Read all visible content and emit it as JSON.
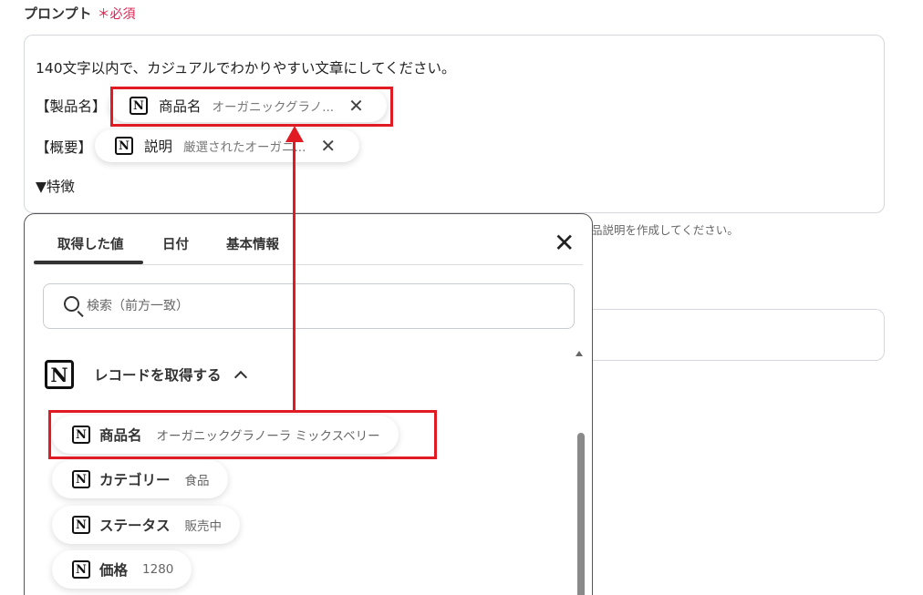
{
  "form": {
    "label": "プロンプト",
    "required_label": "＊必須"
  },
  "prompt": {
    "line1": "140文字以内で、カジュアルでわかりやすい文章にしてください。",
    "product_label": "【製品名】",
    "overview_label": "【概要】",
    "features_label": "▼特徴",
    "chips": [
      {
        "name": "商品名",
        "value": "オーガニックグラノ..."
      },
      {
        "name": "説明",
        "value": "厳選されたオーガニ..."
      }
    ]
  },
  "hint_text": "品説明を作成してください。",
  "picker": {
    "tabs": [
      {
        "label": "取得した値",
        "active": true
      },
      {
        "label": "日付"
      },
      {
        "label": "基本情報"
      }
    ],
    "search_placeholder": "検索（前方一致）",
    "group_label": "レコードを取得する",
    "items": [
      {
        "name": "商品名",
        "value": "オーガニックグラノーラ ミックスベリー"
      },
      {
        "name": "カテゴリー",
        "value": "食品"
      },
      {
        "name": "ステータス",
        "value": "販売中"
      },
      {
        "name": "価格",
        "value": "1280"
      }
    ]
  },
  "icons": {
    "notion": "notion-icon",
    "remove": "close-icon",
    "close": "close-icon",
    "search": "search-icon",
    "collapse": "chevron-up-icon"
  },
  "colors": {
    "accent_red": "#e01b24",
    "required_red": "#e0204e",
    "border": "#d4d8dd"
  }
}
